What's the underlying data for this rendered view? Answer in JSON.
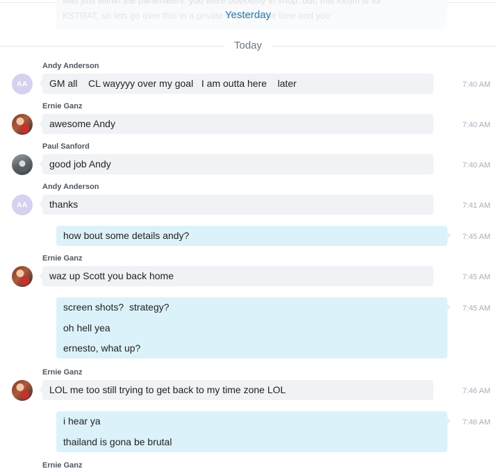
{
  "top_ghost": {
    "line1": "was just within the paramaters. you were obviously in shop. but, this forum is for",
    "line2": "KSTRAT, so lets go over this in a private thread some time and you"
  },
  "sticky_date": "Yesterday",
  "divider_label": "Today",
  "messages": [
    {
      "sender": "Andy Anderson",
      "avatar": "AA",
      "text": "GM all    CL wayyyy over my goal   I am outta here    later",
      "time": "7:40 AM"
    },
    {
      "sender": "Ernie Ganz",
      "text": "awesome Andy",
      "time": "7:40 AM"
    },
    {
      "sender": "Paul Sanford",
      "text": "good job Andy",
      "time": "7:40 AM"
    },
    {
      "sender": "Andy Anderson",
      "avatar": "AA",
      "text": "thanks",
      "time": "7:41 AM"
    },
    {
      "mine": true,
      "lines": [
        "how bout some details andy?"
      ],
      "time": "7:45 AM"
    },
    {
      "sender": "Ernie Ganz",
      "text": "waz up Scott you back home",
      "time": "7:45 AM"
    },
    {
      "mine": true,
      "lines": [
        "screen shots?  strategy?",
        "oh hell yea",
        "ernesto, what up?"
      ],
      "time": "7:45 AM"
    },
    {
      "sender": "Ernie Ganz",
      "text": "LOL me too still trying to get back to my time zone LOL",
      "time": "7:46 AM"
    },
    {
      "mine": true,
      "lines": [
        "i hear ya",
        "thailand is gona be brutal"
      ],
      "time": "7:46 AM"
    },
    {
      "sender": "Ernie Ganz"
    }
  ]
}
